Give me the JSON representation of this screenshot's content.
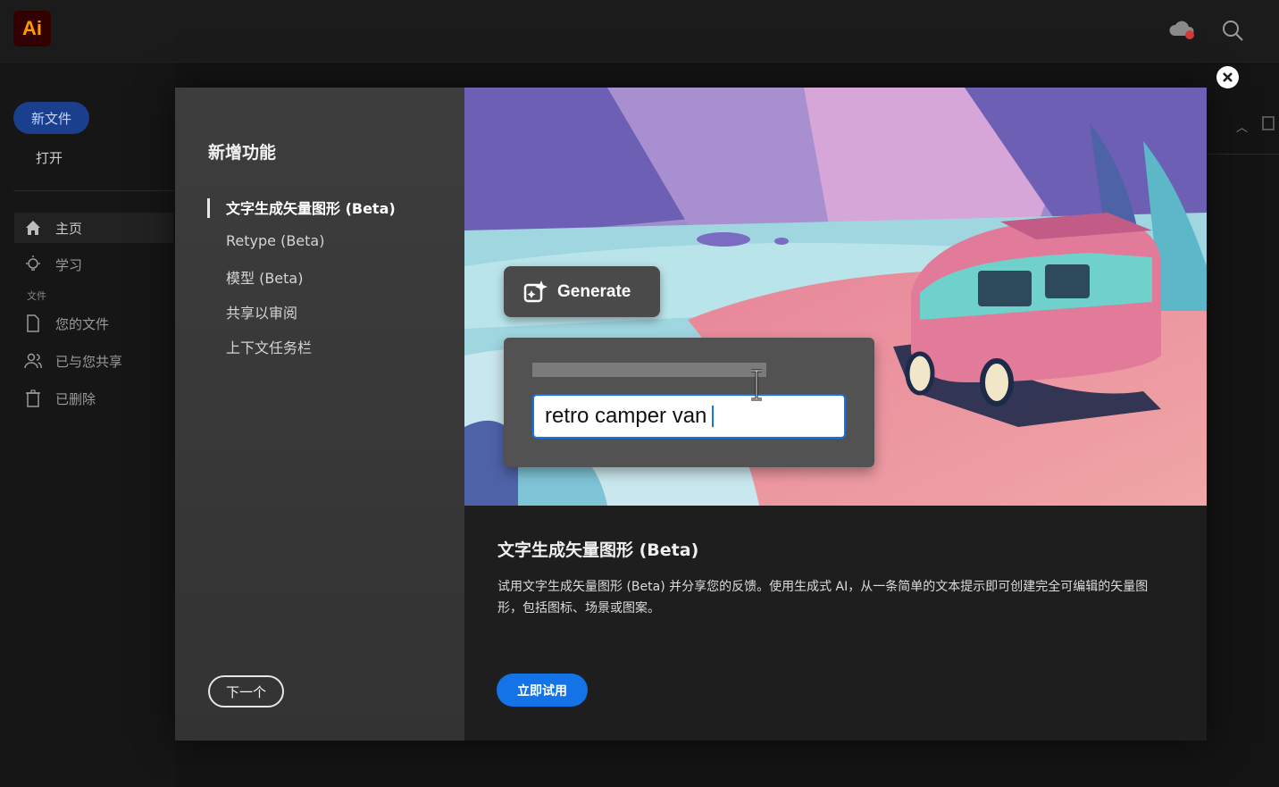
{
  "app": {
    "logo_text": "Ai"
  },
  "sidebar": {
    "new_file": "新文件",
    "open": "打开",
    "section_files": "文件",
    "items": [
      {
        "label": "主页",
        "icon": "home-icon"
      },
      {
        "label": "学习",
        "icon": "lightbulb-icon"
      },
      {
        "label": "您的文件",
        "icon": "file-icon"
      },
      {
        "label": "已与您共享",
        "icon": "shared-users-icon"
      },
      {
        "label": "已删除",
        "icon": "trash-icon"
      }
    ]
  },
  "modal": {
    "title": "新增功能",
    "features": [
      "文字生成矢量图形 (Beta)",
      "Retype (Beta)",
      "模型 (Beta)",
      "共享以审阅",
      "上下文任务栏"
    ],
    "active_index": 0,
    "next_button": "下一个",
    "hero": {
      "generate_label": "Generate",
      "prompt_text": "retro camper van"
    },
    "detail_title": "文字生成矢量图形 (Beta)",
    "detail_description": "试用文字生成矢量图形 (Beta) 并分享您的反馈。使用生成式 AI，从一条简单的文本提示即可创建完全可编辑的矢量图形，包括图标、场景或图案。",
    "try_button": "立即试用"
  },
  "colors": {
    "accent": "#1473e6",
    "logo_bg": "#330000",
    "logo_fg": "#ff9a00"
  }
}
